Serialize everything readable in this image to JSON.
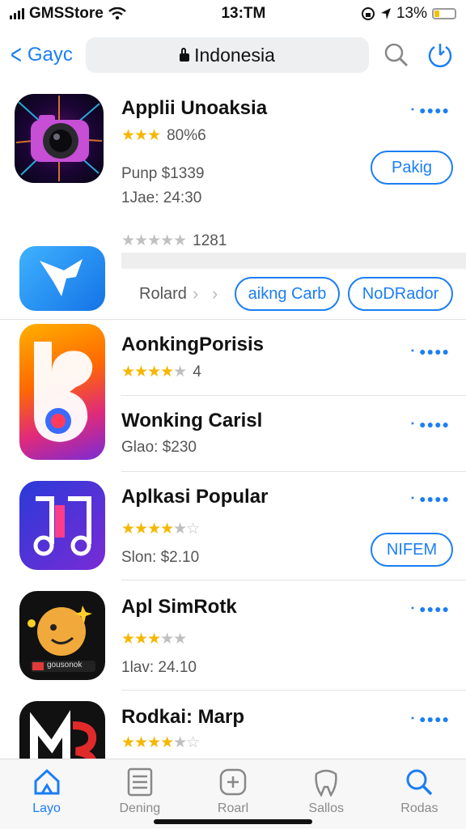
{
  "status_bar": {
    "carrier": "GMSStore",
    "time": "13:TM",
    "battery": "13%"
  },
  "nav": {
    "back_label": "Gayc",
    "url": "Indonesia"
  },
  "featured": {
    "title": "Applii Unoaksia",
    "rating_text": "80%6",
    "price_line": "Punp $1339",
    "date_line": "1Jae: 24:30",
    "action_label": "Pakig",
    "review_count": "1281"
  },
  "secondary": {
    "label": "Rolard",
    "chip_1": "aikng Carb",
    "chip_2": "NoDRador"
  },
  "apps": [
    {
      "title": "AonkingPorisis",
      "rating_value": "4"
    },
    {
      "title": "Wonking Carisl",
      "meta": "Glao: $230"
    },
    {
      "title": "Aplkasi Popular",
      "meta": "Slon: $2.10",
      "action_label": "NIFEM"
    },
    {
      "title": "Apl SimRotk",
      "meta": "1lav: 24.10",
      "icon_label": "gousonok"
    },
    {
      "title": "Rodkai: Marp"
    }
  ],
  "tabs": [
    {
      "label": "Layo",
      "icon": "home-icon"
    },
    {
      "label": "Dening",
      "icon": "list-icon"
    },
    {
      "label": "Roarl",
      "icon": "plus-square-icon"
    },
    {
      "label": "Sallos",
      "icon": "tooth-icon"
    },
    {
      "label": "Rodas",
      "icon": "search-icon"
    }
  ],
  "colors": {
    "accent": "#1b7ef5",
    "star": "#f5b700"
  }
}
